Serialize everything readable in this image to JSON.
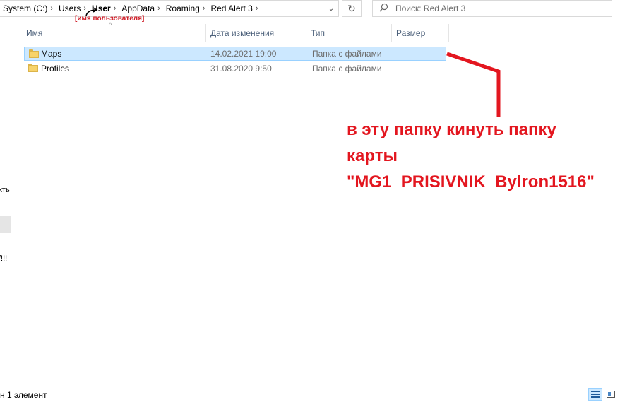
{
  "address": {
    "crumbs": [
      "System (C:)",
      "Users",
      "User",
      "AppData",
      "Roaming",
      "Red Alert 3"
    ],
    "separator": "›",
    "dropdown_glyph": "⌄",
    "refresh_glyph": "↻"
  },
  "user_note": "[имя пользователя]",
  "search": {
    "placeholder": "Поиск: Red Alert 3",
    "icon": "search-icon"
  },
  "left_pane": {
    "fragment1": "кть",
    "fragment2": "/!!!"
  },
  "columns": {
    "name": "Имя",
    "date": "Дата изменения",
    "type": "Тип",
    "size": "Размер",
    "sort_glyph": "^"
  },
  "files": [
    {
      "name": "Maps",
      "date": "14.02.2021 19:00",
      "type": "Папка с файлами",
      "size": "",
      "selected": true
    },
    {
      "name": "Profiles",
      "date": "31.08.2020 9:50",
      "type": "Папка с файлами",
      "size": "",
      "selected": false
    }
  ],
  "annotation": {
    "line1": "в эту папку кинуть папку",
    "line2": "карты",
    "line3": "\"MG1_PRISIVNIK_Bylron1516\"",
    "color": "#e3161f"
  },
  "status": {
    "text": "н 1 элемент"
  },
  "colors": {
    "selection_bg": "#cce8ff",
    "selection_border": "#99d1ff",
    "header_text": "#4c607a",
    "annotation_red": "#e3161f"
  }
}
